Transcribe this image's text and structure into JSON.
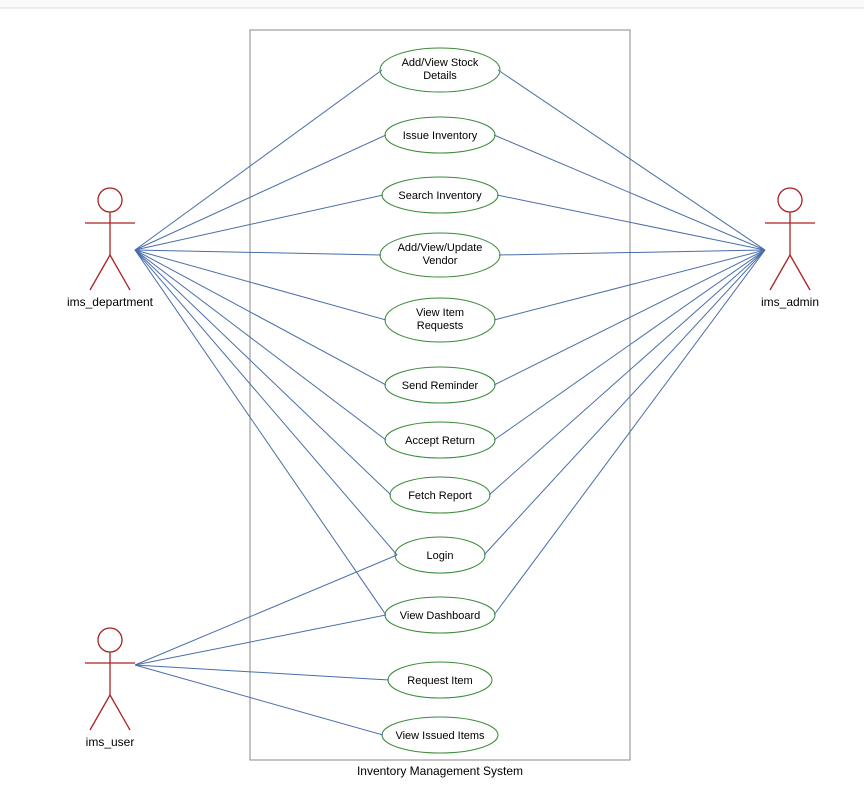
{
  "diagram": {
    "system_name": "Inventory Management System",
    "actors": {
      "left_top": "ims_department",
      "right": "ims_admin",
      "left_bottom": "ims_user"
    },
    "usecases": {
      "uc1": "Add/View Stock",
      "uc1b": "Details",
      "uc2": "Issue Inventory",
      "uc3": "Search Inventory",
      "uc4": "Add/View/Update",
      "uc4b": "Vendor",
      "uc5": "View Item",
      "uc5b": "Requests",
      "uc6": "Send Reminder",
      "uc7": "Accept Return",
      "uc8": "Fetch Report",
      "uc9": "Login",
      "uc10": "View Dashboard",
      "uc11": "Request Item",
      "uc12": "View Issued Items"
    }
  }
}
